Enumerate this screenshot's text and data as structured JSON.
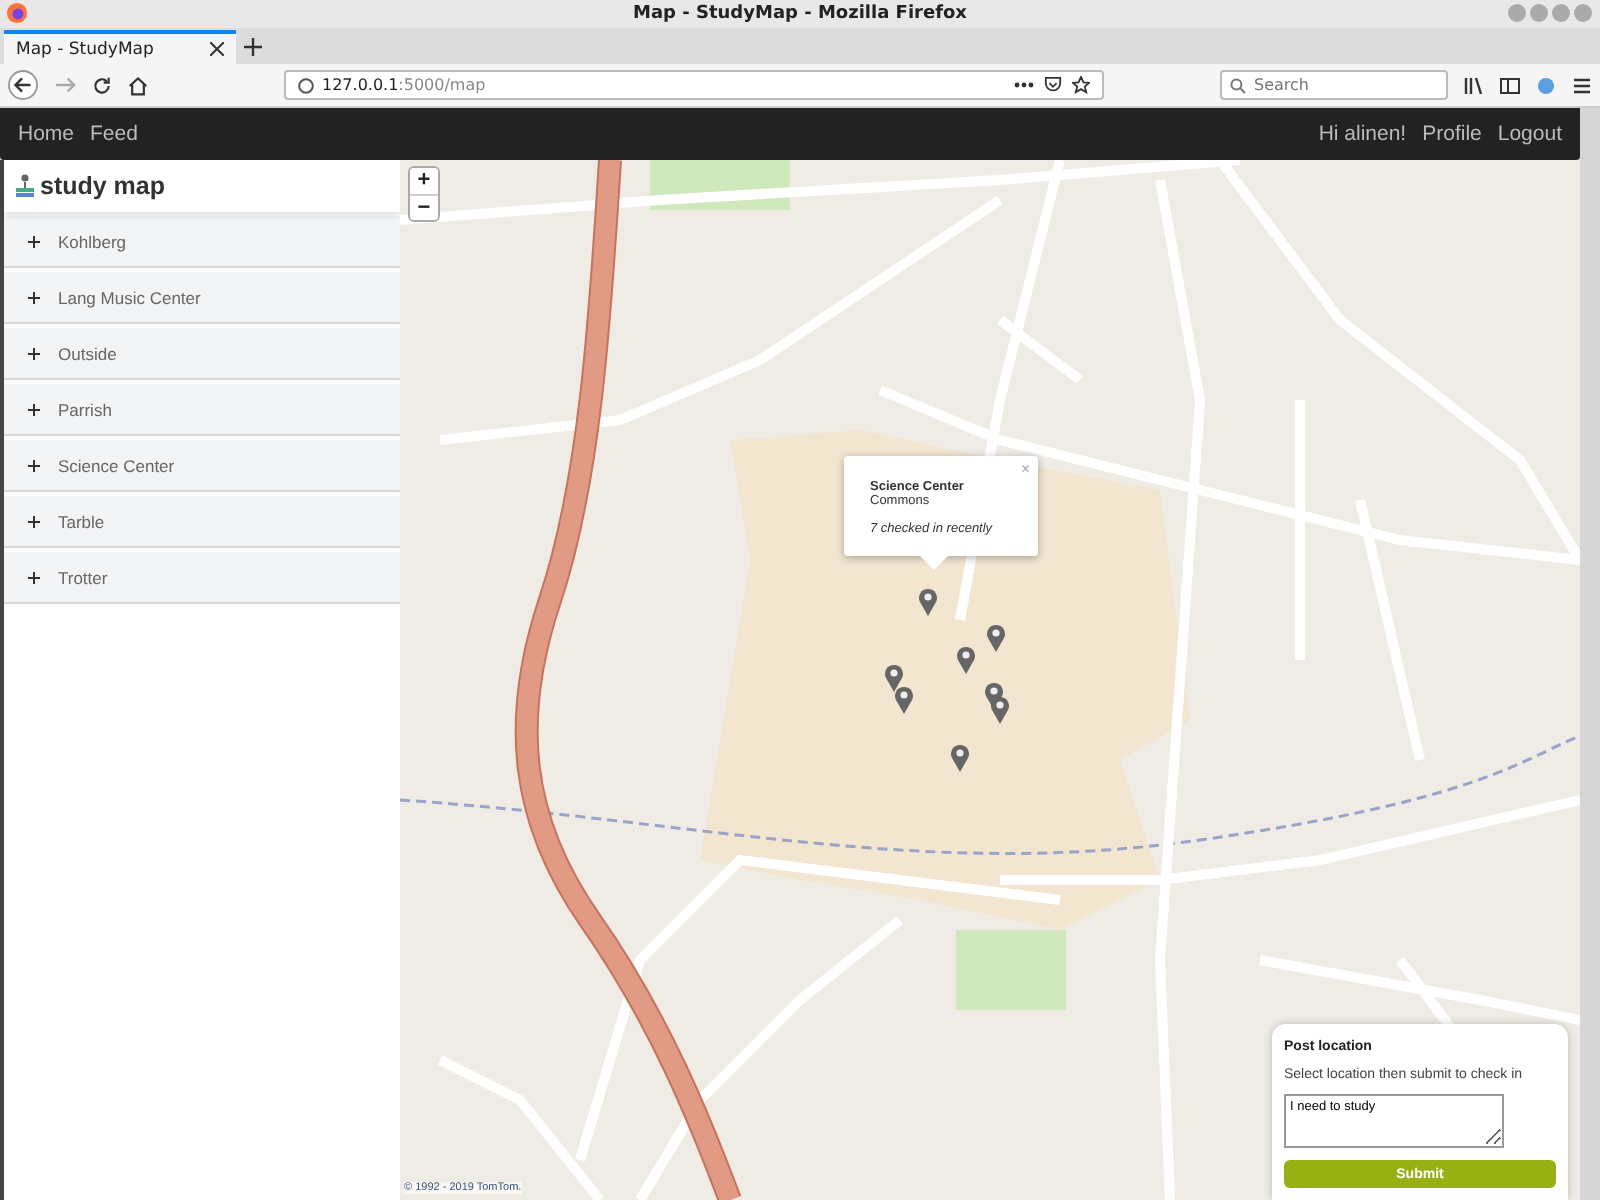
{
  "window": {
    "title": "Map - StudyMap - Mozilla Firefox"
  },
  "tabs": [
    {
      "label": "Map - StudyMap",
      "selected": true
    }
  ],
  "address_bar": {
    "host": "127.0.0.1",
    "path": ":5000/map"
  },
  "search": {
    "placeholder": "Search"
  },
  "navbar": {
    "left": [
      "Home",
      "Feed"
    ],
    "greeting": "Hi alinen!",
    "right": [
      "Profile",
      "Logout"
    ]
  },
  "sidebar": {
    "brand": "study map",
    "items": [
      {
        "label": "Kohlberg",
        "expanded": false
      },
      {
        "label": "Lang Music Center",
        "expanded": false
      },
      {
        "label": "Outside",
        "expanded": false
      },
      {
        "label": "Parrish",
        "expanded": false
      },
      {
        "label": "Science Center",
        "expanded": false
      },
      {
        "label": "Tarble",
        "expanded": false
      },
      {
        "label": "Trotter",
        "expanded": false
      }
    ]
  },
  "map": {
    "zoom_in": "+",
    "zoom_out": "−",
    "attribution": "© 1992 - 2019 TomTom.",
    "popup": {
      "close": "×",
      "title": "Science Center",
      "subtitle": "Commons",
      "note": "7 checked in recently"
    }
  },
  "post_panel": {
    "title": "Post location",
    "hint": "Select location then submit to check in",
    "message": {
      "value": "I need to study"
    },
    "button": "Submit"
  }
}
